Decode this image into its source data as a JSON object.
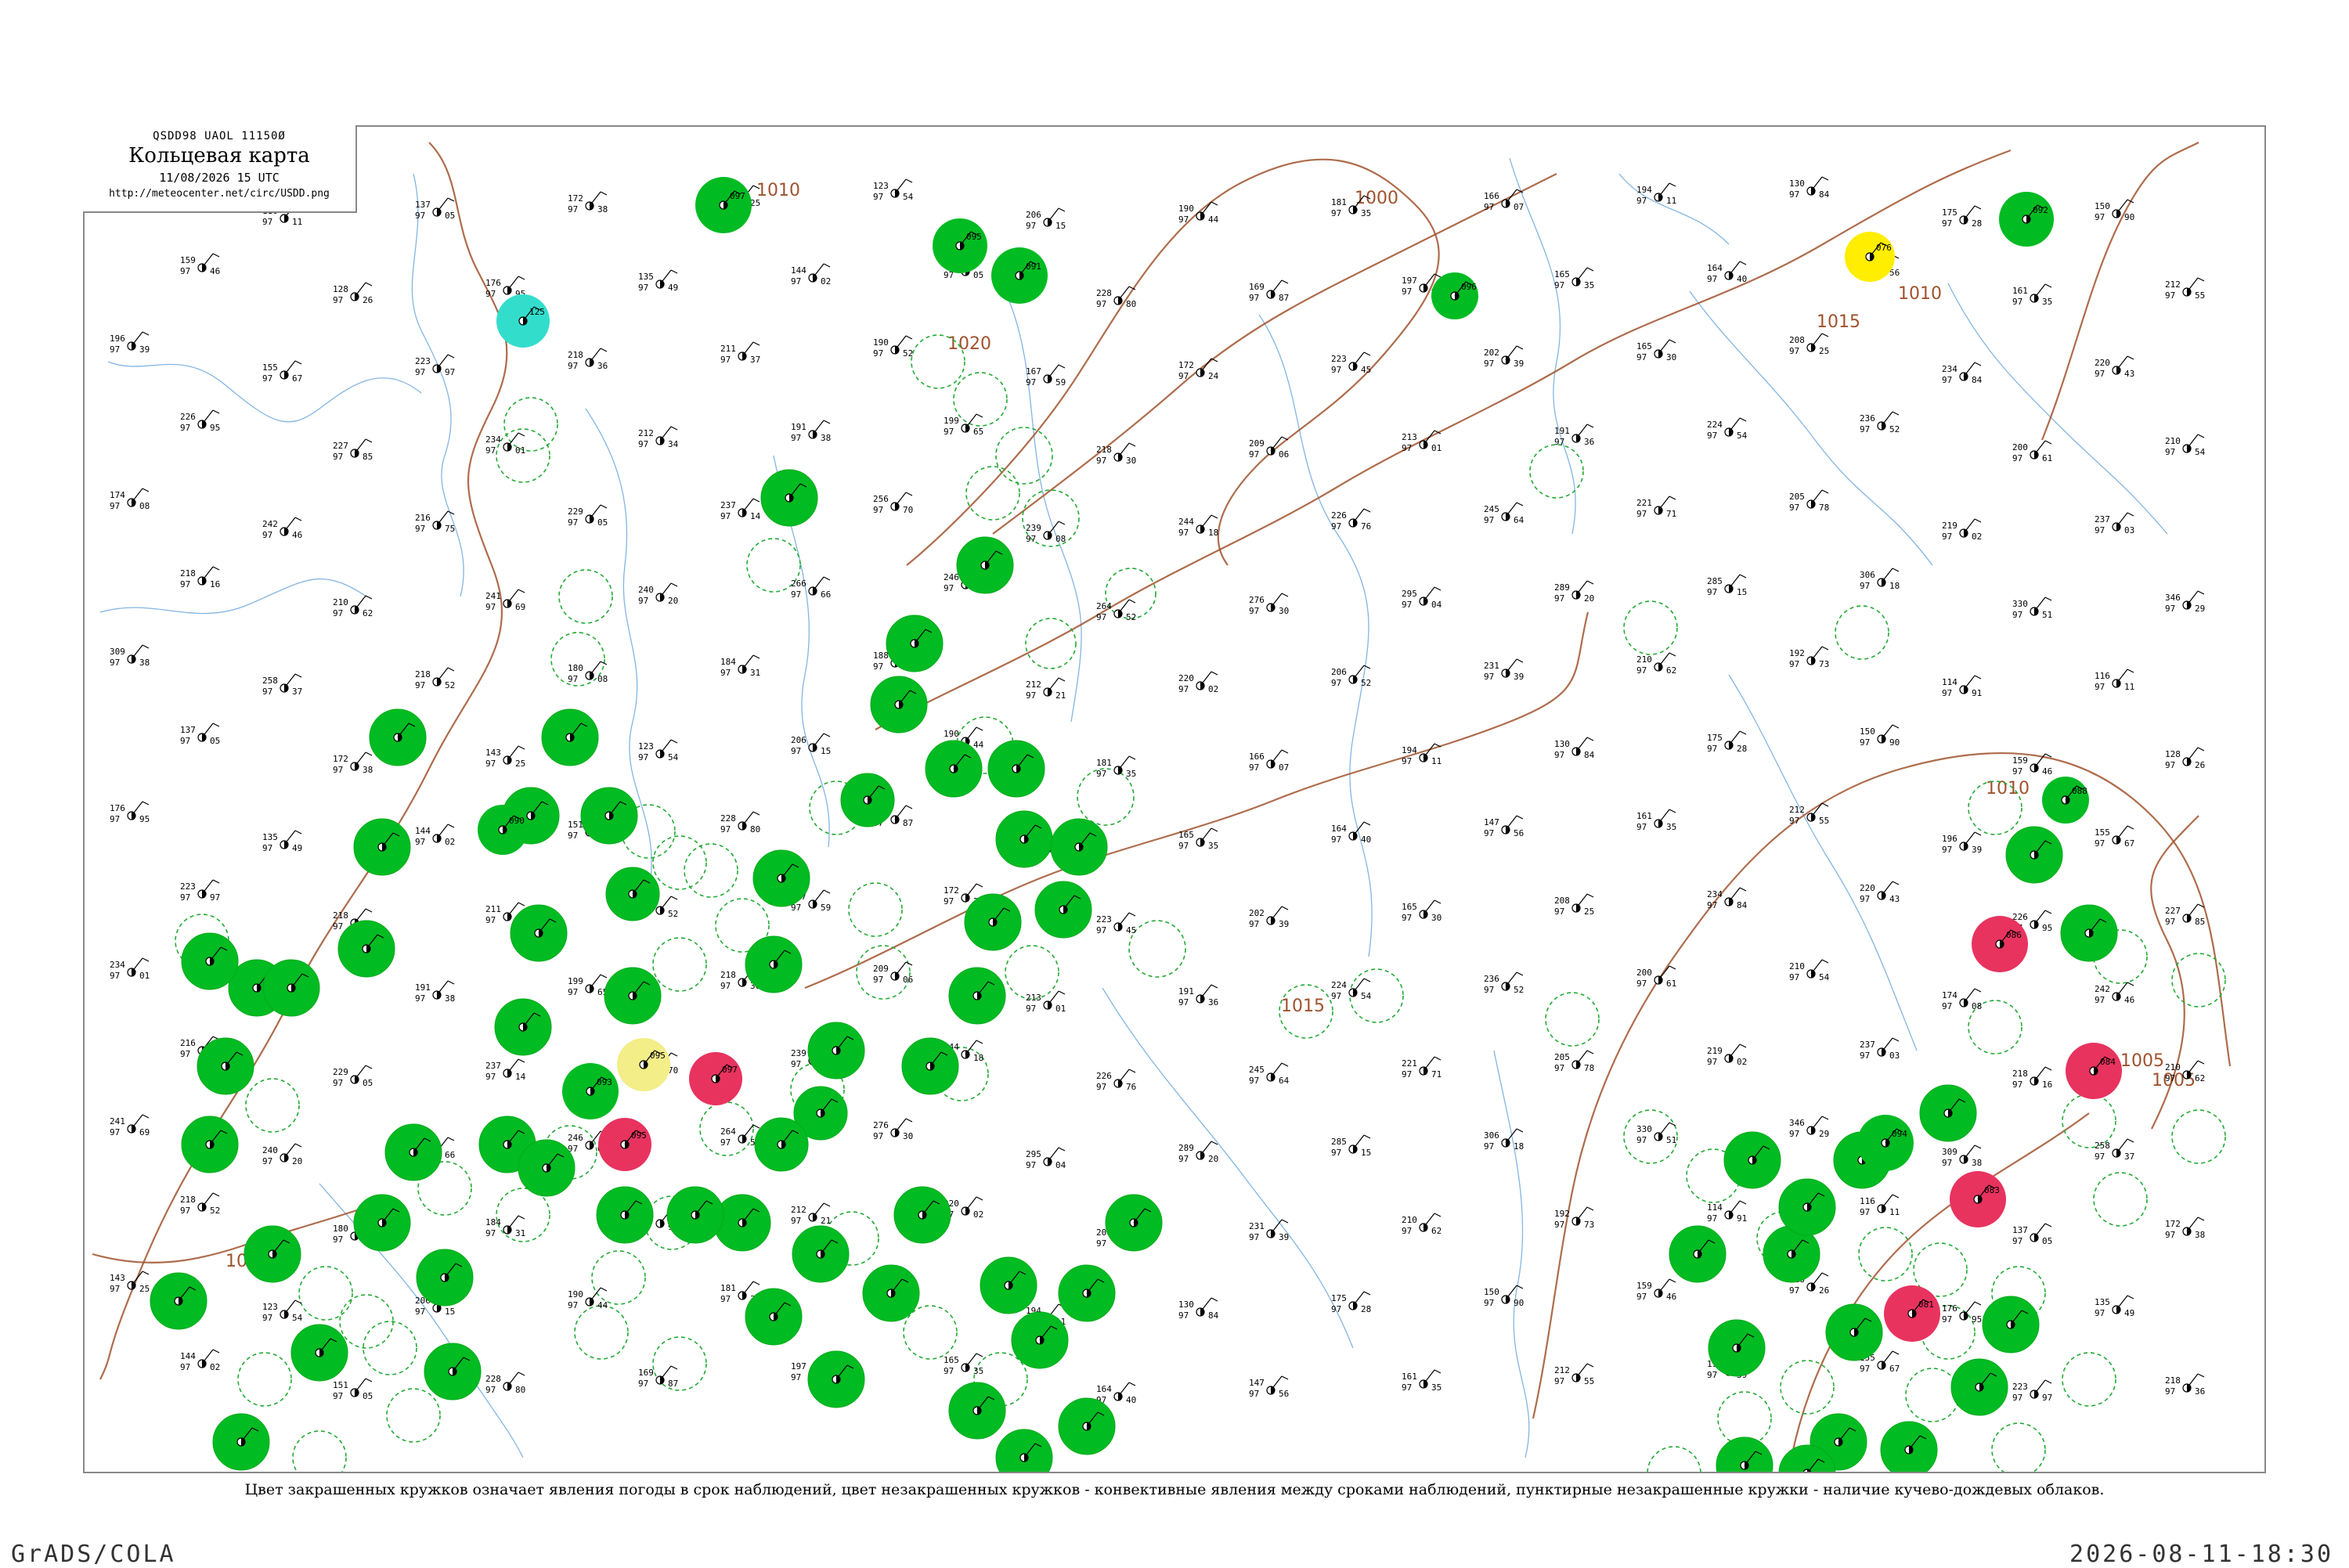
{
  "header": {
    "code": "QSDD98  UAOL  11150Ø",
    "title": "Кольцевая карта",
    "time": "11/08/2026 15 UTC",
    "url": "http://meteocenter.net/circ/USDD.png"
  },
  "caption": "Цвет закрашенных кружков означает явления погоды в срок наблюдений, цвет незакрашенных кружков - конвективные явления между сроками наблюдений, пунктирные незакрашенные кружки - наличие кучево-дождевых облаков.",
  "footer": {
    "left": "GrADS/COLA",
    "right": "2026-08-11-18:30"
  },
  "colors": {
    "green": "#00bb22",
    "teal": "#33ddcc",
    "yellow": "#ffee00",
    "light_yellow": "#f3ee88",
    "red": "#e8335f",
    "isobar": "#a0522d",
    "river": "#6fa8dc"
  },
  "isobars": [
    {
      "label": "1010"
    },
    {
      "label": "1000"
    },
    {
      "label": "1005"
    },
    {
      "label": "1010"
    },
    {
      "label": "1015"
    },
    {
      "label": "1015"
    },
    {
      "label": "1010"
    },
    {
      "label": "1015"
    },
    {
      "label": "1005"
    },
    {
      "label": "1020"
    }
  ],
  "filled_circles": [
    {
      "kind": "green",
      "code": "097"
    },
    {
      "kind": "green",
      "code": "095"
    },
    {
      "kind": "green",
      "code": "092"
    },
    {
      "kind": "teal",
      "code": "125"
    },
    {
      "kind": "green",
      "code": "096"
    },
    {
      "kind": "green",
      "code": "091"
    },
    {
      "kind": "green",
      "code": "088"
    },
    {
      "kind": "green",
      "code": "090"
    },
    {
      "kind": "green",
      "code": "093"
    },
    {
      "kind": "green",
      "code": "094"
    },
    {
      "kind": "yellow",
      "code": "076"
    },
    {
      "kind": "light_yellow",
      "code": "095"
    },
    {
      "kind": "red",
      "code": "097"
    },
    {
      "kind": "red",
      "code": "095"
    },
    {
      "kind": "red",
      "code": "086"
    },
    {
      "kind": "red",
      "code": "084"
    },
    {
      "kind": "red",
      "code": "083"
    },
    {
      "kind": "red",
      "code": "081"
    }
  ],
  "stations": [
    {
      "p": "114",
      "t": "97",
      "d": "91"
    },
    {
      "p": "116",
      "t": "97",
      "d": "11"
    },
    {
      "p": "137",
      "t": "97",
      "d": "05"
    },
    {
      "p": "172",
      "t": "97",
      "d": "38"
    },
    {
      "p": "143",
      "t": "97",
      "d": "25"
    },
    {
      "p": "123",
      "t": "97",
      "d": "54"
    },
    {
      "p": "206",
      "t": "97",
      "d": "15"
    },
    {
      "p": "190",
      "t": "97",
      "d": "44"
    },
    {
      "p": "181",
      "t": "97",
      "d": "35"
    },
    {
      "p": "166",
      "t": "97",
      "d": "07"
    },
    {
      "p": "194",
      "t": "97",
      "d": "11"
    },
    {
      "p": "130",
      "t": "97",
      "d": "84"
    },
    {
      "p": "175",
      "t": "97",
      "d": "28"
    },
    {
      "p": "150",
      "t": "97",
      "d": "90"
    },
    {
      "p": "159",
      "t": "97",
      "d": "46"
    },
    {
      "p": "128",
      "t": "97",
      "d": "26"
    },
    {
      "p": "176",
      "t": "97",
      "d": "95"
    },
    {
      "p": "135",
      "t": "97",
      "d": "49"
    },
    {
      "p": "144",
      "t": "97",
      "d": "02"
    },
    {
      "p": "151",
      "t": "97",
      "d": "05"
    },
    {
      "p": "228",
      "t": "97",
      "d": "80"
    },
    {
      "p": "169",
      "t": "97",
      "d": "87"
    },
    {
      "p": "197",
      "t": "97",
      "d": "97"
    },
    {
      "p": "165",
      "t": "97",
      "d": "35"
    },
    {
      "p": "164",
      "t": "97",
      "d": "40"
    },
    {
      "p": "147",
      "t": "97",
      "d": "56"
    },
    {
      "p": "161",
      "t": "97",
      "d": "35"
    },
    {
      "p": "212",
      "t": "97",
      "d": "55"
    },
    {
      "p": "196",
      "t": "97",
      "d": "39"
    },
    {
      "p": "155",
      "t": "97",
      "d": "67"
    },
    {
      "p": "223",
      "t": "97",
      "d": "97"
    },
    {
      "p": "218",
      "t": "97",
      "d": "36"
    },
    {
      "p": "211",
      "t": "97",
      "d": "37"
    },
    {
      "p": "190",
      "t": "97",
      "d": "52"
    },
    {
      "p": "167",
      "t": "97",
      "d": "59"
    },
    {
      "p": "172",
      "t": "97",
      "d": "24"
    },
    {
      "p": "223",
      "t": "97",
      "d": "45"
    },
    {
      "p": "202",
      "t": "97",
      "d": "39"
    },
    {
      "p": "165",
      "t": "97",
      "d": "30"
    },
    {
      "p": "208",
      "t": "97",
      "d": "25"
    },
    {
      "p": "234",
      "t": "97",
      "d": "84"
    },
    {
      "p": "220",
      "t": "97",
      "d": "43"
    },
    {
      "p": "226",
      "t": "97",
      "d": "95"
    },
    {
      "p": "227",
      "t": "97",
      "d": "85"
    },
    {
      "p": "234",
      "t": "97",
      "d": "01"
    },
    {
      "p": "212",
      "t": "97",
      "d": "34"
    },
    {
      "p": "191",
      "t": "97",
      "d": "38"
    },
    {
      "p": "199",
      "t": "97",
      "d": "65"
    },
    {
      "p": "218",
      "t": "97",
      "d": "30"
    },
    {
      "p": "209",
      "t": "97",
      "d": "06"
    },
    {
      "p": "213",
      "t": "97",
      "d": "01"
    },
    {
      "p": "191",
      "t": "97",
      "d": "36"
    },
    {
      "p": "224",
      "t": "97",
      "d": "54"
    },
    {
      "p": "236",
      "t": "97",
      "d": "52"
    },
    {
      "p": "200",
      "t": "97",
      "d": "61"
    },
    {
      "p": "210",
      "t": "97",
      "d": "54"
    },
    {
      "p": "174",
      "t": "97",
      "d": "08"
    },
    {
      "p": "242",
      "t": "97",
      "d": "46"
    },
    {
      "p": "216",
      "t": "97",
      "d": "75"
    },
    {
      "p": "229",
      "t": "97",
      "d": "05"
    },
    {
      "p": "237",
      "t": "97",
      "d": "14"
    },
    {
      "p": "256",
      "t": "97",
      "d": "70"
    },
    {
      "p": "239",
      "t": "97",
      "d": "08"
    },
    {
      "p": "244",
      "t": "97",
      "d": "18"
    },
    {
      "p": "226",
      "t": "97",
      "d": "76"
    },
    {
      "p": "245",
      "t": "97",
      "d": "64"
    },
    {
      "p": "221",
      "t": "97",
      "d": "71"
    },
    {
      "p": "205",
      "t": "97",
      "d": "78"
    },
    {
      "p": "219",
      "t": "97",
      "d": "02"
    },
    {
      "p": "237",
      "t": "97",
      "d": "03"
    },
    {
      "p": "218",
      "t": "97",
      "d": "16"
    },
    {
      "p": "210",
      "t": "97",
      "d": "62"
    },
    {
      "p": "241",
      "t": "97",
      "d": "69"
    },
    {
      "p": "240",
      "t": "97",
      "d": "20"
    },
    {
      "p": "266",
      "t": "97",
      "d": "66"
    },
    {
      "p": "246",
      "t": "97",
      "d": "64"
    },
    {
      "p": "264",
      "t": "97",
      "d": "52"
    },
    {
      "p": "276",
      "t": "97",
      "d": "30"
    },
    {
      "p": "295",
      "t": "97",
      "d": "04"
    },
    {
      "p": "289",
      "t": "97",
      "d": "20"
    },
    {
      "p": "285",
      "t": "97",
      "d": "15"
    },
    {
      "p": "306",
      "t": "97",
      "d": "18"
    },
    {
      "p": "330",
      "t": "97",
      "d": "51"
    },
    {
      "p": "346",
      "t": "97",
      "d": "29"
    },
    {
      "p": "309",
      "t": "97",
      "d": "38"
    },
    {
      "p": "258",
      "t": "97",
      "d": "37"
    },
    {
      "p": "218",
      "t": "97",
      "d": "52"
    },
    {
      "p": "180",
      "t": "97",
      "d": "08"
    },
    {
      "p": "184",
      "t": "97",
      "d": "31"
    },
    {
      "p": "188",
      "t": "97",
      "d": "99"
    },
    {
      "p": "212",
      "t": "97",
      "d": "21"
    },
    {
      "p": "220",
      "t": "97",
      "d": "02"
    },
    {
      "p": "206",
      "t": "97",
      "d": "52"
    },
    {
      "p": "231",
      "t": "97",
      "d": "39"
    },
    {
      "p": "210",
      "t": "97",
      "d": "62"
    },
    {
      "p": "192",
      "t": "97",
      "d": "73"
    }
  ]
}
